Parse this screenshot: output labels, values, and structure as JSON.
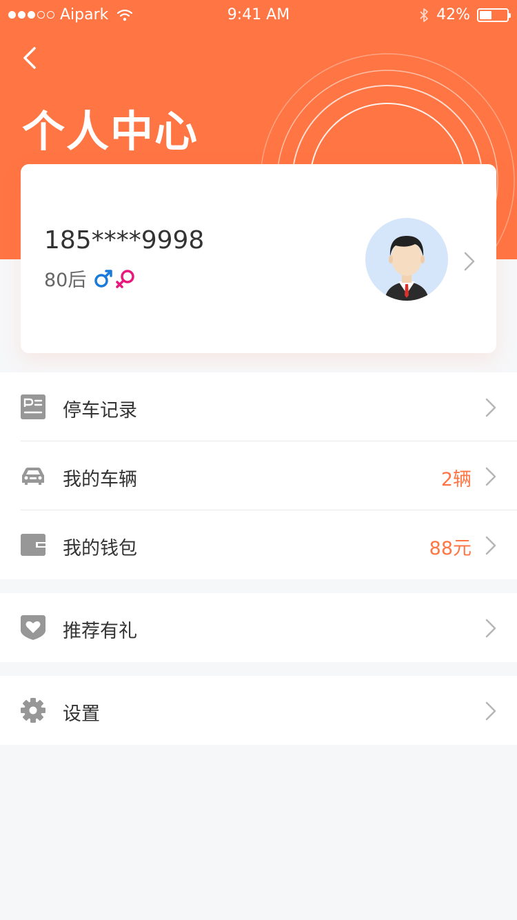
{
  "status_bar": {
    "carrier": "Aipark",
    "time": "9:41 AM",
    "battery": "42%",
    "battery_level": 0.42
  },
  "header": {
    "title": "个人中心",
    "background_color": "#ff7543"
  },
  "profile": {
    "phone": "185****9998",
    "age_group": "80后",
    "gender_icons": [
      "male-icon",
      "female-icon"
    ]
  },
  "menu": [
    {
      "label": "停车记录",
      "value": "",
      "icon": "parking-record-icon"
    },
    {
      "label": "我的车辆",
      "value": "2辆",
      "icon": "car-icon"
    },
    {
      "label": "我的钱包",
      "value": "88元",
      "icon": "wallet-icon"
    },
    {
      "label": "推荐有礼",
      "value": "",
      "icon": "heart-gift-icon"
    },
    {
      "label": "设置",
      "value": "",
      "icon": "gear-icon"
    }
  ],
  "colors": {
    "accent": "#ff7543",
    "male": "#1a7ad9",
    "female": "#e8187c",
    "icon_gray": "#979797"
  }
}
